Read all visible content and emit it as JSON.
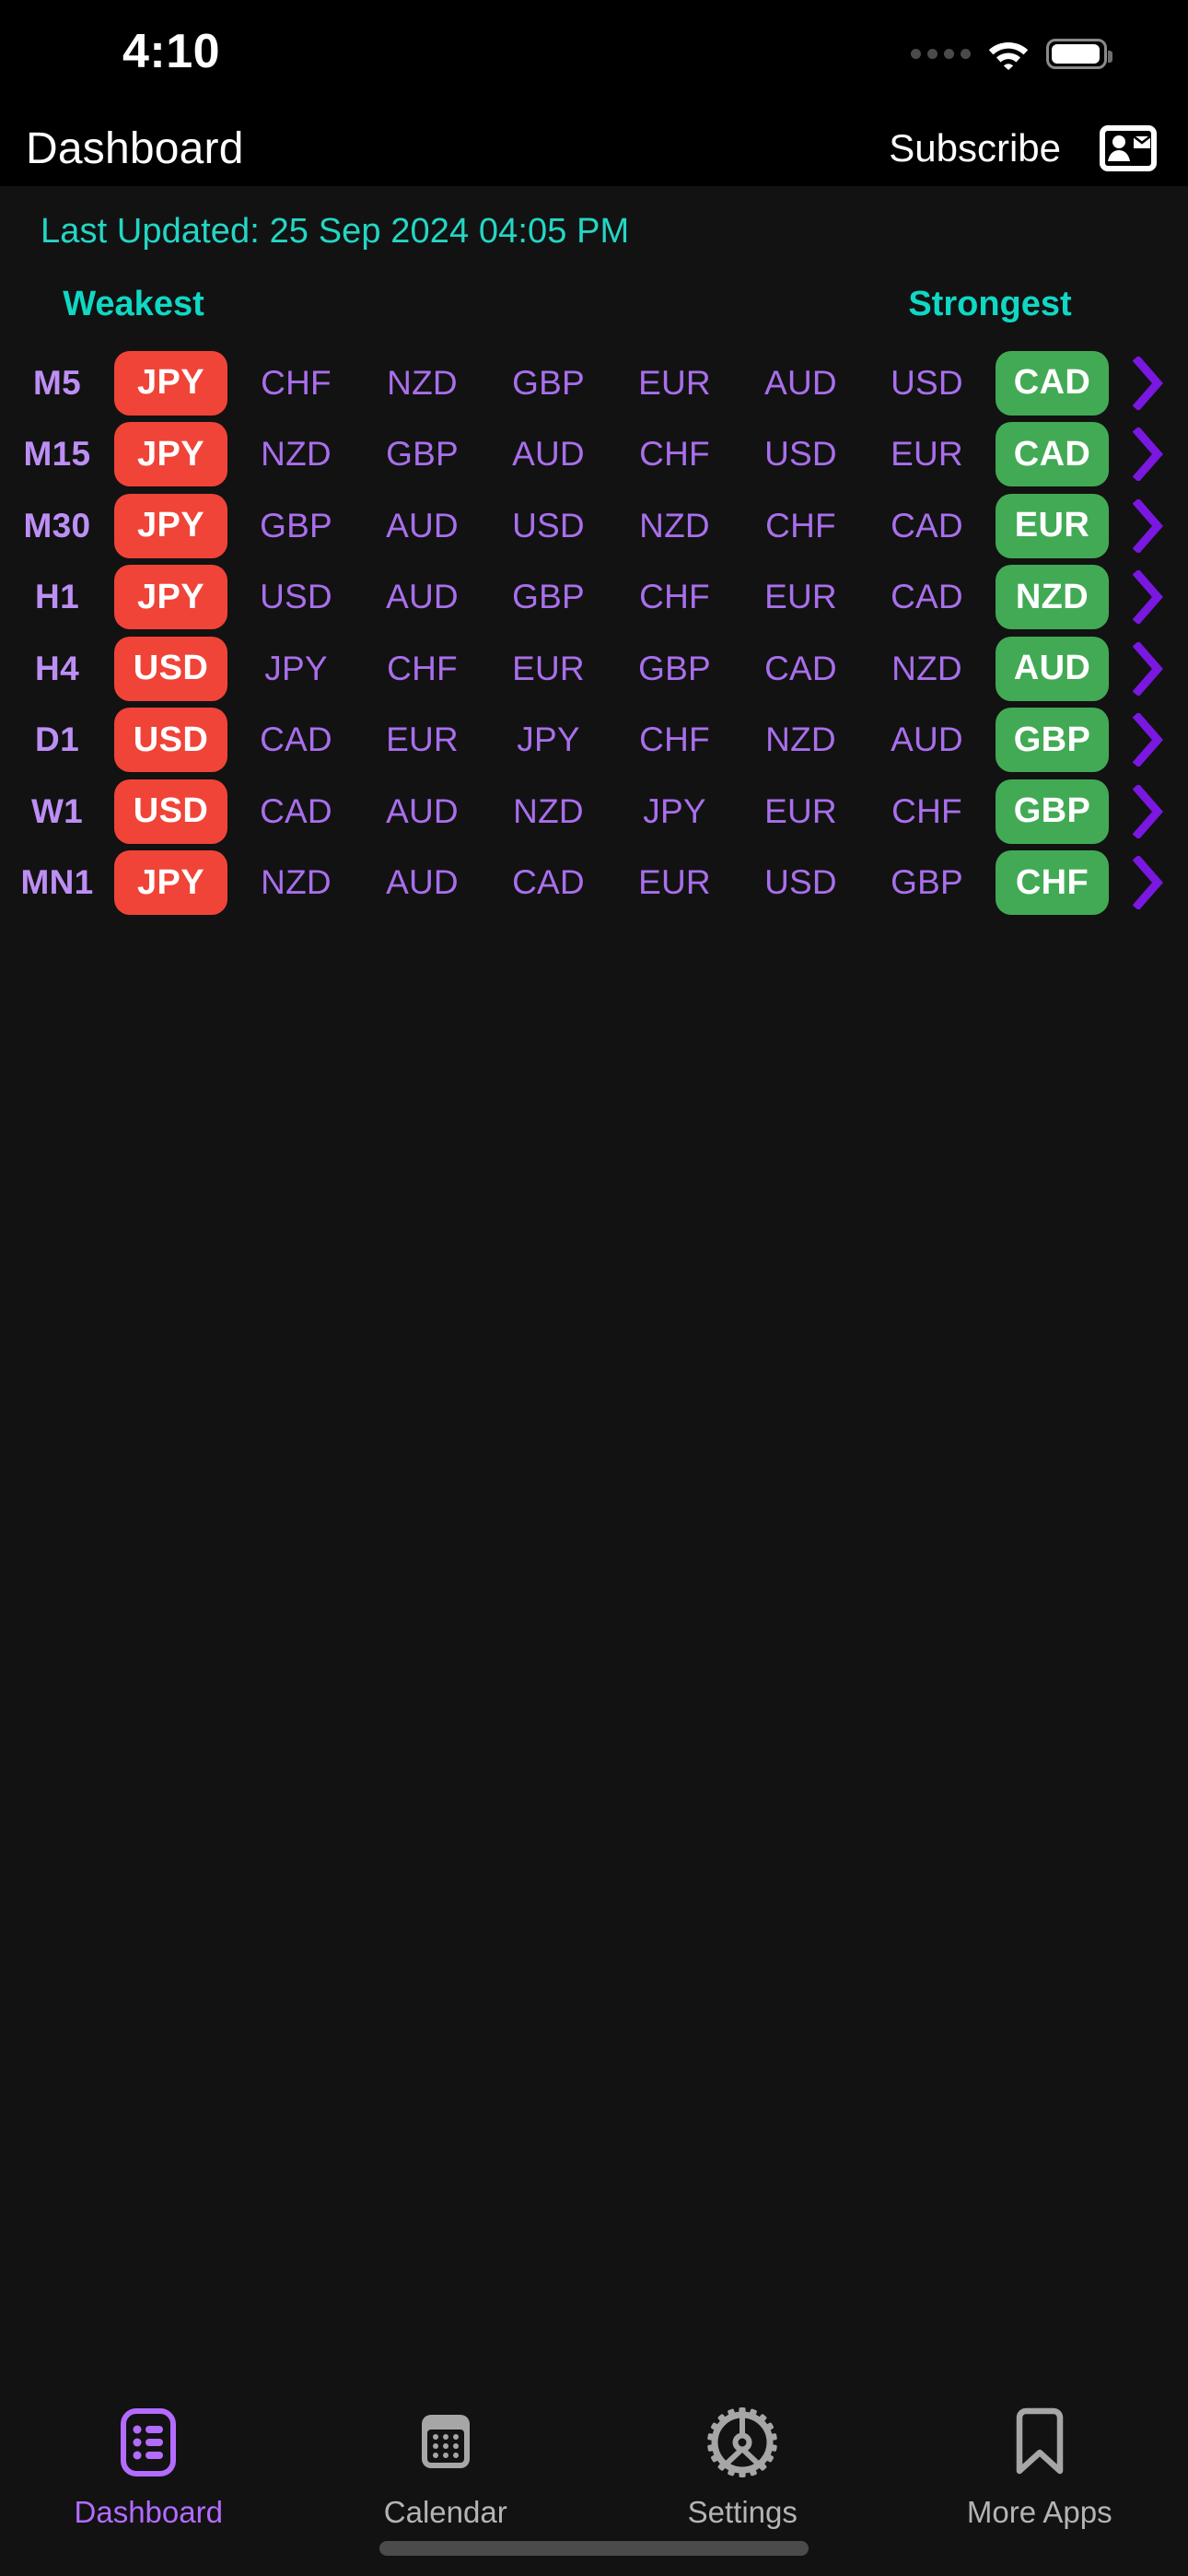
{
  "status_bar": {
    "time": "4:10",
    "cellular_icon": "cellular-dots-icon",
    "wifi_icon": "wifi-icon",
    "battery_icon": "battery-icon"
  },
  "header": {
    "title": "Dashboard",
    "subscribe_label": "Subscribe",
    "contact_card_icon": "contact-card-icon"
  },
  "main": {
    "last_updated": "Last Updated: 25 Sep 2024 04:05 PM",
    "weakest_label": "Weakest",
    "strongest_label": "Strongest",
    "colors": {
      "weak_badge": "#f04438",
      "strong_badge": "#42aa55",
      "accent_cyan": "#0fd8c4",
      "timeframe_purple": "#bd8ff5",
      "currency_purple": "#a96fec",
      "chevron_purple": "#7a17e0",
      "background": "#121212",
      "header_background": "#000000"
    },
    "rows": [
      {
        "timeframe": "M5",
        "weakest": "JPY",
        "middle": [
          "CHF",
          "NZD",
          "GBP",
          "EUR",
          "AUD",
          "USD"
        ],
        "strongest": "CAD",
        "chevron_icon": "chevron-right-icon"
      },
      {
        "timeframe": "M15",
        "weakest": "JPY",
        "middle": [
          "NZD",
          "GBP",
          "AUD",
          "CHF",
          "USD",
          "EUR"
        ],
        "strongest": "CAD",
        "chevron_icon": "chevron-right-icon"
      },
      {
        "timeframe": "M30",
        "weakest": "JPY",
        "middle": [
          "GBP",
          "AUD",
          "USD",
          "NZD",
          "CHF",
          "CAD"
        ],
        "strongest": "EUR",
        "chevron_icon": "chevron-right-icon"
      },
      {
        "timeframe": "H1",
        "weakest": "JPY",
        "middle": [
          "USD",
          "AUD",
          "GBP",
          "CHF",
          "EUR",
          "CAD"
        ],
        "strongest": "NZD",
        "chevron_icon": "chevron-right-icon"
      },
      {
        "timeframe": "H4",
        "weakest": "USD",
        "middle": [
          "JPY",
          "CHF",
          "EUR",
          "GBP",
          "CAD",
          "NZD"
        ],
        "strongest": "AUD",
        "chevron_icon": "chevron-right-icon"
      },
      {
        "timeframe": "D1",
        "weakest": "USD",
        "middle": [
          "CAD",
          "EUR",
          "JPY",
          "CHF",
          "NZD",
          "AUD"
        ],
        "strongest": "GBP",
        "chevron_icon": "chevron-right-icon"
      },
      {
        "timeframe": "W1",
        "weakest": "USD",
        "middle": [
          "CAD",
          "AUD",
          "NZD",
          "JPY",
          "EUR",
          "CHF"
        ],
        "strongest": "GBP",
        "chevron_icon": "chevron-right-icon"
      },
      {
        "timeframe": "MN1",
        "weakest": "JPY",
        "middle": [
          "NZD",
          "AUD",
          "CAD",
          "EUR",
          "USD",
          "GBP"
        ],
        "strongest": "CHF",
        "chevron_icon": "chevron-right-icon"
      }
    ]
  },
  "tab_bar": {
    "items": [
      {
        "label": "Dashboard",
        "icon": "list-icon",
        "active": true
      },
      {
        "label": "Calendar",
        "icon": "calendar-icon",
        "active": false
      },
      {
        "label": "Settings",
        "icon": "gear-icon",
        "active": false
      },
      {
        "label": "More Apps",
        "icon": "bookmark-icon",
        "active": false
      }
    ]
  }
}
